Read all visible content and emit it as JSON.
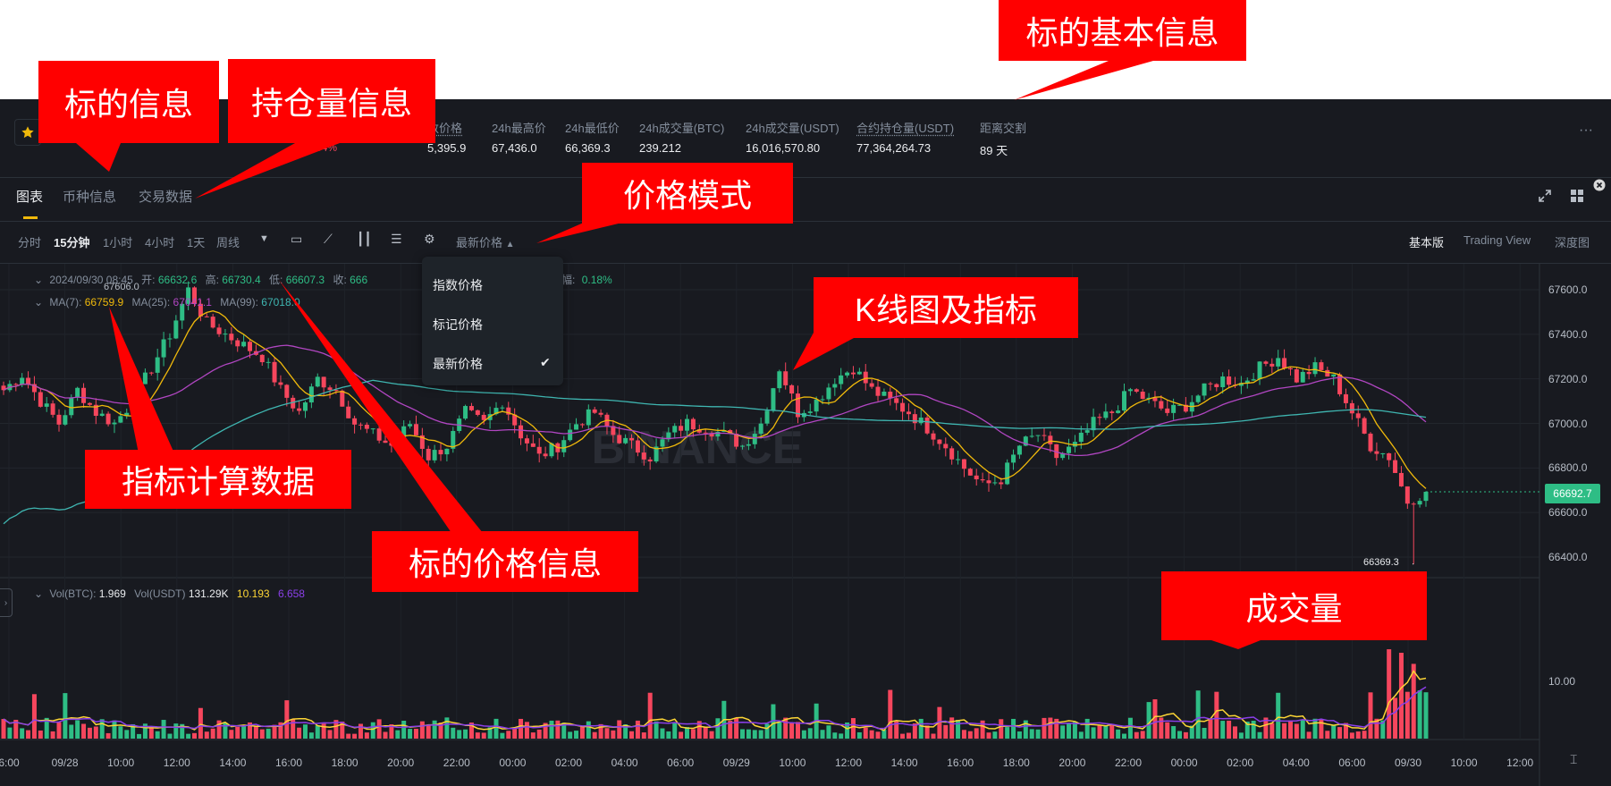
{
  "header": {
    "change_pct": "0.54%",
    "stats": [
      {
        "label": "数价格",
        "value": "5,395.9",
        "underline": true
      },
      {
        "label": "24h最高价",
        "value": "67,436.0"
      },
      {
        "label": "24h最低价",
        "value": "66,369.3"
      },
      {
        "label": "24h成交量(BTC)",
        "value": "239.212"
      },
      {
        "label": "24h成交量(USDT)",
        "value": "16,016,570.80"
      },
      {
        "label": "合约持仓量(USDT)",
        "value": "77,364,264.73",
        "underline": true
      },
      {
        "label": "距离交割",
        "value": "89 天"
      }
    ],
    "more_label": "···"
  },
  "tabs": [
    {
      "label": "图表",
      "active": true
    },
    {
      "label": "币种信息"
    },
    {
      "label": "交易数据"
    }
  ],
  "toolbar": {
    "timeframes": [
      "分时",
      "15分钟",
      "1小时",
      "4小时",
      "1天",
      "周线"
    ],
    "active_timeframe": "15分钟",
    "price_mode_label": "最新价格",
    "versions": [
      "基本版",
      "Trading View",
      "深度图"
    ],
    "active_version": "基本版"
  },
  "price_menu": {
    "options": [
      "指数价格",
      "标记价格",
      "最新价格"
    ],
    "selected": "最新价格"
  },
  "ohlc_legend": {
    "datetime": "2024/09/30 08:45",
    "open_label": "开:",
    "open": "66632.6",
    "high_label": "高:",
    "high": "66730.4",
    "low_label": "低:",
    "low": "66607.3",
    "close_label": "收:",
    "close": "666",
    "amp_label": "幅:",
    "amp": "0.18%"
  },
  "ma_legend": {
    "ma7_label": "MA(7):",
    "ma7": "66759.9",
    "ma25_label": "MA(25):",
    "ma25": "67041.1",
    "ma99_label": "MA(99):",
    "ma99": "67018.0"
  },
  "vol_legend": {
    "btc_label": "Vol(BTC):",
    "btc": "1.969",
    "usdt_label": "Vol(USDT)",
    "usdt": "131.29K",
    "v1": "10.193",
    "v2": "6.658"
  },
  "watermark": "BINANCE",
  "colors": {
    "up": "#2ebd85",
    "down": "#f6465d",
    "ma7": "#f0b90b",
    "ma25": "#b146c2",
    "ma99": "#3fb6b1",
    "vol_ma1": "#fcd535",
    "vol_ma2": "#8a3fe8",
    "accent": "#f0b90b",
    "callout": "#ff0000"
  },
  "chart_data": {
    "type": "candlestick",
    "y_ticks": [
      67600,
      67400,
      67200,
      67000,
      66800,
      66600,
      66400
    ],
    "y_range": [
      66300,
      67680
    ],
    "x_ticks": [
      "6:00",
      "09/28",
      "10:00",
      "12:00",
      "14:00",
      "16:00",
      "18:00",
      "20:00",
      "22:00",
      "00:00",
      "02:00",
      "04:00",
      "06:00",
      "09/29",
      "10:00",
      "12:00",
      "14:00",
      "16:00",
      "18:00",
      "20:00",
      "22:00",
      "00:00",
      "02:00",
      "04:00",
      "06:00",
      "09/30",
      "10:00",
      "12:00"
    ],
    "current_price": "66692.7",
    "max_label": "67606.0",
    "min_label": "66369.3",
    "vol_tick": "10.00",
    "close_path": [
      67150,
      67220,
      67100,
      67000,
      67150,
      67050,
      67000,
      67100,
      67250,
      67400,
      67600,
      67450,
      67400,
      67350,
      67300,
      67150,
      67050,
      67200,
      67150,
      67000,
      66950,
      66900,
      67000,
      66850,
      66900,
      67050,
      67000,
      67100,
      66950,
      66850,
      66900,
      67000,
      67050,
      66950,
      66900,
      66850,
      66950,
      67000,
      66980,
      66950,
      66900,
      67000,
      67250,
      67050,
      67100,
      67200,
      67250,
      67150,
      67100,
      67050,
      66980,
      66900,
      66800,
      66720,
      66750,
      66900,
      66950,
      66850,
      66900,
      67000,
      67050,
      67150,
      67100,
      67050,
      67080,
      67150,
      67200,
      67180,
      67250,
      67300,
      67200,
      67250,
      67200,
      67050,
      66900,
      66850,
      66650,
      66693
    ]
  }
}
